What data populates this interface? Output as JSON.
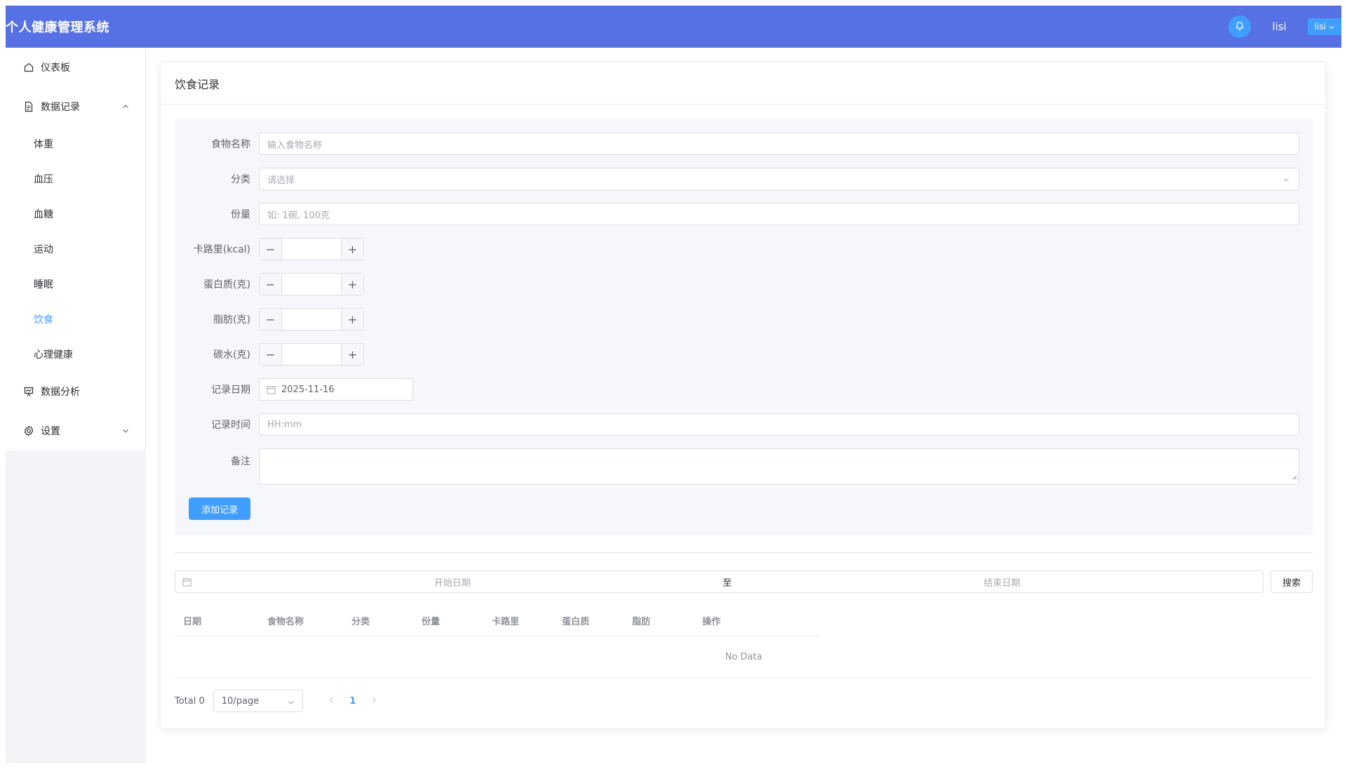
{
  "header": {
    "brand": "个人健康管理系统",
    "username": "lisi",
    "user_dropdown": "lisi",
    "icons": [
      "bell-icon",
      "chevron-down-icon"
    ]
  },
  "sidebar": {
    "dashboard": "仪表板",
    "data_records": "数据记录",
    "sub_items": [
      "体重",
      "血压",
      "血糖",
      "运动",
      "睡眠",
      "饮食",
      "心理健康"
    ],
    "active_sub": "饮食",
    "analysis": "数据分析",
    "settings": "设置"
  },
  "card": {
    "title": "饮食记录"
  },
  "form": {
    "food_name_label": "食物名称",
    "food_name_placeholder": "输入食物名称",
    "category_label": "分类",
    "category_placeholder": "请选择",
    "portion_label": "份量",
    "portion_placeholder": "如: 1碗, 100克",
    "calories_label": "卡路里(kcal)",
    "protein_label": "蛋白质(克)",
    "fat_label": "脂肪(克)",
    "carbs_label": "碳水(克)",
    "date_label": "记录日期",
    "date_value": "2025-11-16",
    "time_label": "记录时间",
    "time_placeholder": "HH:mm",
    "notes_label": "备注",
    "submit_label": "添加记录"
  },
  "filter": {
    "start_placeholder": "开始日期",
    "separator": "至",
    "end_placeholder": "结束日期",
    "search_label": "搜索"
  },
  "table": {
    "columns": [
      "日期",
      "食物名称",
      "分类",
      "份量",
      "卡路里",
      "蛋白质",
      "脂肪",
      "操作"
    ],
    "empty_text": "No Data"
  },
  "pagination": {
    "total": "Total 0",
    "page_size": "10/page",
    "current_page": "1"
  },
  "colors": {
    "header_bg": "#5671e3",
    "accent": "#409eff",
    "form_bg": "#f5f7fa"
  }
}
